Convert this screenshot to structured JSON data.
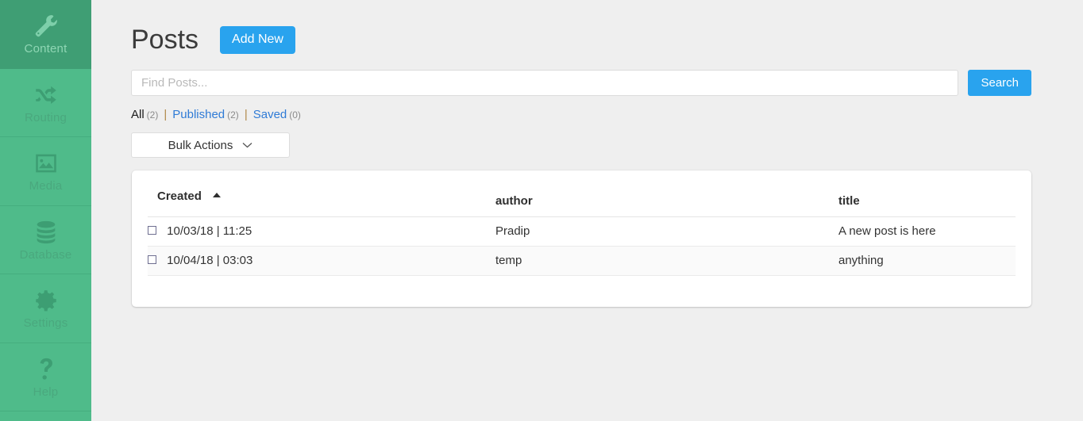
{
  "sidebar": {
    "items": [
      {
        "label": "Content",
        "icon": "wrench-icon",
        "active": true
      },
      {
        "label": "Routing",
        "icon": "shuffle-icon",
        "active": false
      },
      {
        "label": "Media",
        "icon": "image-icon",
        "active": false
      },
      {
        "label": "Database",
        "icon": "database-icon",
        "active": false
      },
      {
        "label": "Settings",
        "icon": "gear-icon",
        "active": false
      },
      {
        "label": "Help",
        "icon": "question-icon",
        "active": false
      }
    ]
  },
  "header": {
    "title": "Posts",
    "add_new_label": "Add New"
  },
  "search": {
    "placeholder": "Find Posts...",
    "value": "",
    "button_label": "Search"
  },
  "filters": {
    "separator": "|",
    "items": [
      {
        "label": "All",
        "count": "(2)",
        "current": true
      },
      {
        "label": "Published",
        "count": "(2)",
        "current": false
      },
      {
        "label": "Saved",
        "count": "(0)",
        "current": false
      }
    ]
  },
  "bulk": {
    "selected": "Bulk Actions",
    "options": [
      "Bulk Actions"
    ]
  },
  "table": {
    "columns": [
      {
        "key": "created",
        "label": "Created",
        "sorted": "asc"
      },
      {
        "key": "author",
        "label": "author",
        "sorted": ""
      },
      {
        "key": "title",
        "label": "title",
        "sorted": ""
      }
    ],
    "rows": [
      {
        "created": "10/03/18 | 11:25",
        "author": "Pradip",
        "title": "A new post is here",
        "checked": false
      },
      {
        "created": "10/04/18 | 03:03",
        "author": "temp",
        "title": "anything",
        "checked": false
      }
    ]
  },
  "colors": {
    "sidebar": "#4fbb8a",
    "sidebar_active": "#3f9e74",
    "accent": "#29a3ee",
    "link": "#2f7bd6",
    "page_bg": "#efefef"
  }
}
